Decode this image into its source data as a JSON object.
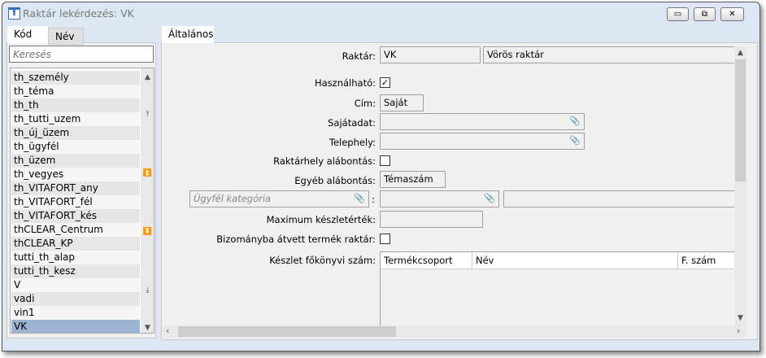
{
  "window": {
    "title": "Raktár lekérdezés: VK",
    "minimize": "▭",
    "restore": "⧉",
    "close": "✕"
  },
  "left": {
    "tabs": [
      "Kód",
      "Név"
    ],
    "search_placeholder": "Keresés",
    "items": [
      "th_személy",
      "th_téma",
      "th_th",
      "th_tutti_uzem",
      "th_új_üzem",
      "th_ügyfél",
      "th_üzem",
      "th_vegyes",
      "th_VITAFORT_any",
      "th_VITAFORT_fél",
      "th_VITAFORT_kés",
      "thCLEAR_Centrum",
      "thCLEAR_KP",
      "tutti_th_alap",
      "tutti_th_kesz",
      "V",
      "vadi",
      "vin1",
      "VK"
    ],
    "selected": "VK"
  },
  "right": {
    "tab": "Általános",
    "fields": {
      "raktar_label": "Raktár:",
      "raktar_code": "VK",
      "raktar_name": "Vörös raktár",
      "hasznalhato_label": "Használható:",
      "hasznalhato": true,
      "cim_label": "Cím:",
      "cim": "Saját",
      "sajatadat_label": "Sajátadat:",
      "telephely_label": "Telephely:",
      "raktarhely_label": "Raktárhely alábontás:",
      "raktarhely": false,
      "egyeb_label": "Egyéb alábontás:",
      "egyeb": "Témaszám",
      "ugyfel_placeholder": "Ügyfél kategória",
      "colon": ":",
      "max_label": "Maximum készletérték:",
      "bizomany_label": "Bizományba átvett termék raktár:",
      "bizomany": false,
      "keszlet_label": "Készlet főkönyvi szám:"
    },
    "grid_headers": [
      "Termékcsoport",
      "Név",
      "F. szám"
    ]
  }
}
